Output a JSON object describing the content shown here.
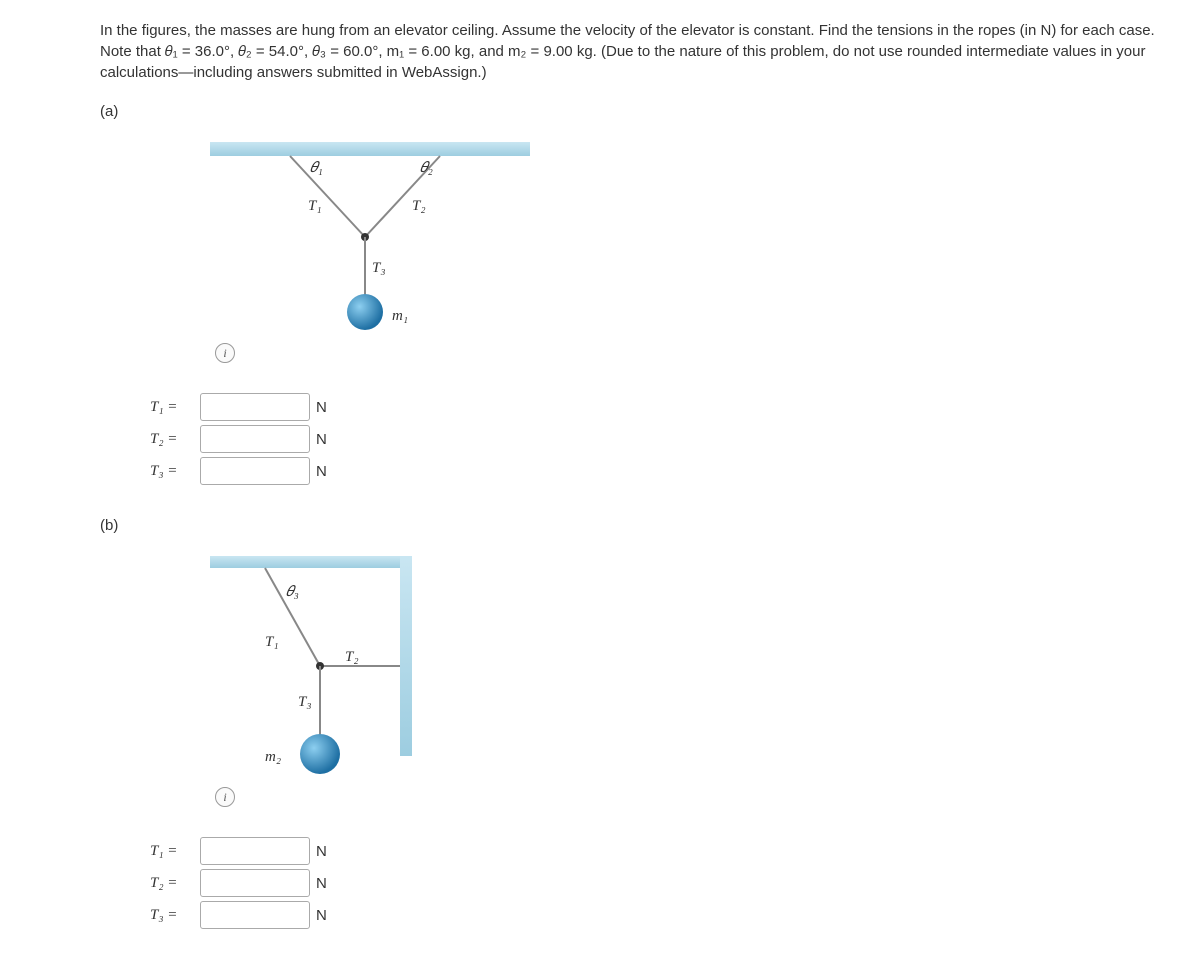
{
  "problem": {
    "intro": "In the figures, the masses are hung from an elevator ceiling. Assume the velocity of the elevator is constant. Find the tensions in the ropes (in N) for each case. Note that ",
    "theta1_eq": "𝜃₁ = 36.0°, ",
    "theta2_eq": "𝜃₂ = 54.0°, ",
    "theta3_eq": "𝜃₃ = 60.0°, ",
    "m1_eq": "m₁ = 6.00 kg, and ",
    "m2_eq": "m₂ = 9.00 kg. ",
    "tail": "(Due to the nature of this problem, do not use rounded intermediate values in your calculations—including answers submitted in WebAssign.)"
  },
  "part_a": {
    "label": "(a)",
    "fig": {
      "theta1": "𝜃₁",
      "theta2": "𝜃₂",
      "T1": "T₁",
      "T2": "T₂",
      "T3": "T₃",
      "m1": "m₁"
    },
    "answers": {
      "T1": {
        "label": "T₁ =",
        "unit": "N"
      },
      "T2": {
        "label": "T₂ =",
        "unit": "N"
      },
      "T3": {
        "label": "T₃ =",
        "unit": "N"
      }
    }
  },
  "part_b": {
    "label": "(b)",
    "fig": {
      "theta3": "𝜃₃",
      "T1": "T₁",
      "T2": "T₂",
      "T3": "T₃",
      "m2": "m₂"
    },
    "answers": {
      "T1": {
        "label": "T₁ =",
        "unit": "N"
      },
      "T2": {
        "label": "T₂ =",
        "unit": "N"
      },
      "T3": {
        "label": "T₃ =",
        "unit": "N"
      }
    }
  },
  "info_glyph": "i"
}
